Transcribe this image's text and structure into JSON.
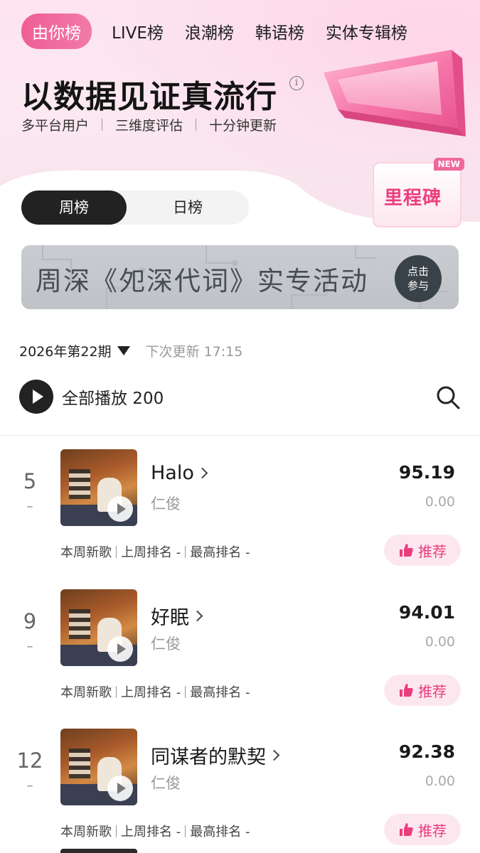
{
  "top_tabs": [
    "由你榜",
    "LIVE榜",
    "浪潮榜",
    "韩语榜",
    "实体专辑榜"
  ],
  "hero": {
    "slogan": "以数据见证真流行",
    "info_icon": "i",
    "features": [
      "多平台用户",
      "三维度评估",
      "十分钟更新"
    ],
    "milestone": "里程碑",
    "new_badge": "NEW"
  },
  "segment": {
    "weekly": "周榜",
    "daily": "日榜"
  },
  "banner": {
    "text": "周深《夗深代词》实专活动",
    "button_line1": "点击",
    "button_line2": "参与"
  },
  "period": {
    "label": "2026年第22期",
    "next_update": "下次更新 17:15"
  },
  "playall": {
    "label": "全部播放 200"
  },
  "songs": [
    {
      "rank": "5",
      "change": "–",
      "title": "Halo",
      "artist": "仁俊",
      "score": "95.19",
      "delta": "0.00",
      "tag_new": "本周新歌",
      "last_week": "上周排名 -",
      "peak": "最高排名 -",
      "recommend": "推荐"
    },
    {
      "rank": "9",
      "change": "–",
      "title": "好眠",
      "artist": "仁俊",
      "score": "94.01",
      "delta": "0.00",
      "tag_new": "本周新歌",
      "last_week": "上周排名 -",
      "peak": "最高排名 -",
      "recommend": "推荐"
    },
    {
      "rank": "12",
      "change": "–",
      "title": "同谋者的默契",
      "artist": "仁俊",
      "score": "92.38",
      "delta": "0.00",
      "tag_new": "本周新歌",
      "last_week": "上周排名 -",
      "peak": "最高排名 -",
      "recommend": "推荐"
    }
  ],
  "colors": {
    "accent_pink": "#ef5e95",
    "recommend_text": "#ea3d7c",
    "dark": "#222222"
  },
  "icons": {
    "play_all": "play-icon",
    "search": "search-icon",
    "recommend": "thumb-up-icon",
    "title_more": "chevron-right-icon"
  }
}
